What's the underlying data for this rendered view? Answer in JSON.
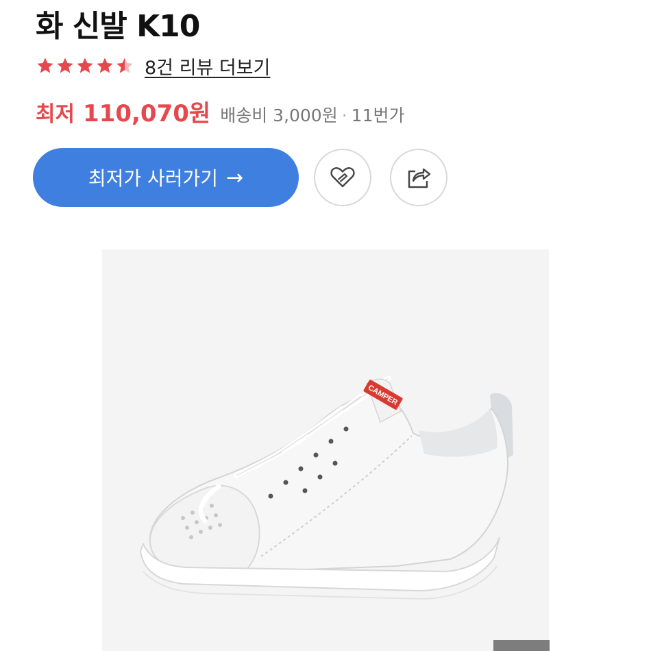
{
  "product": {
    "title": "화 신발 K10",
    "rating_value": 4.5,
    "review_link_label": "8건 리뷰 더보기",
    "price_label": "최저",
    "price_value": "110,070원",
    "shipping": "배송비 3,000원",
    "separator": "·",
    "seller": "11번가"
  },
  "actions": {
    "buy_label": "최저가 사러가기",
    "buy_arrow": "→"
  },
  "image": {
    "brand_tag": "CAMPER"
  },
  "colors": {
    "accent_blue": "#3f7fe0",
    "price_red": "#e5484d",
    "star_red": "#e5484d"
  }
}
